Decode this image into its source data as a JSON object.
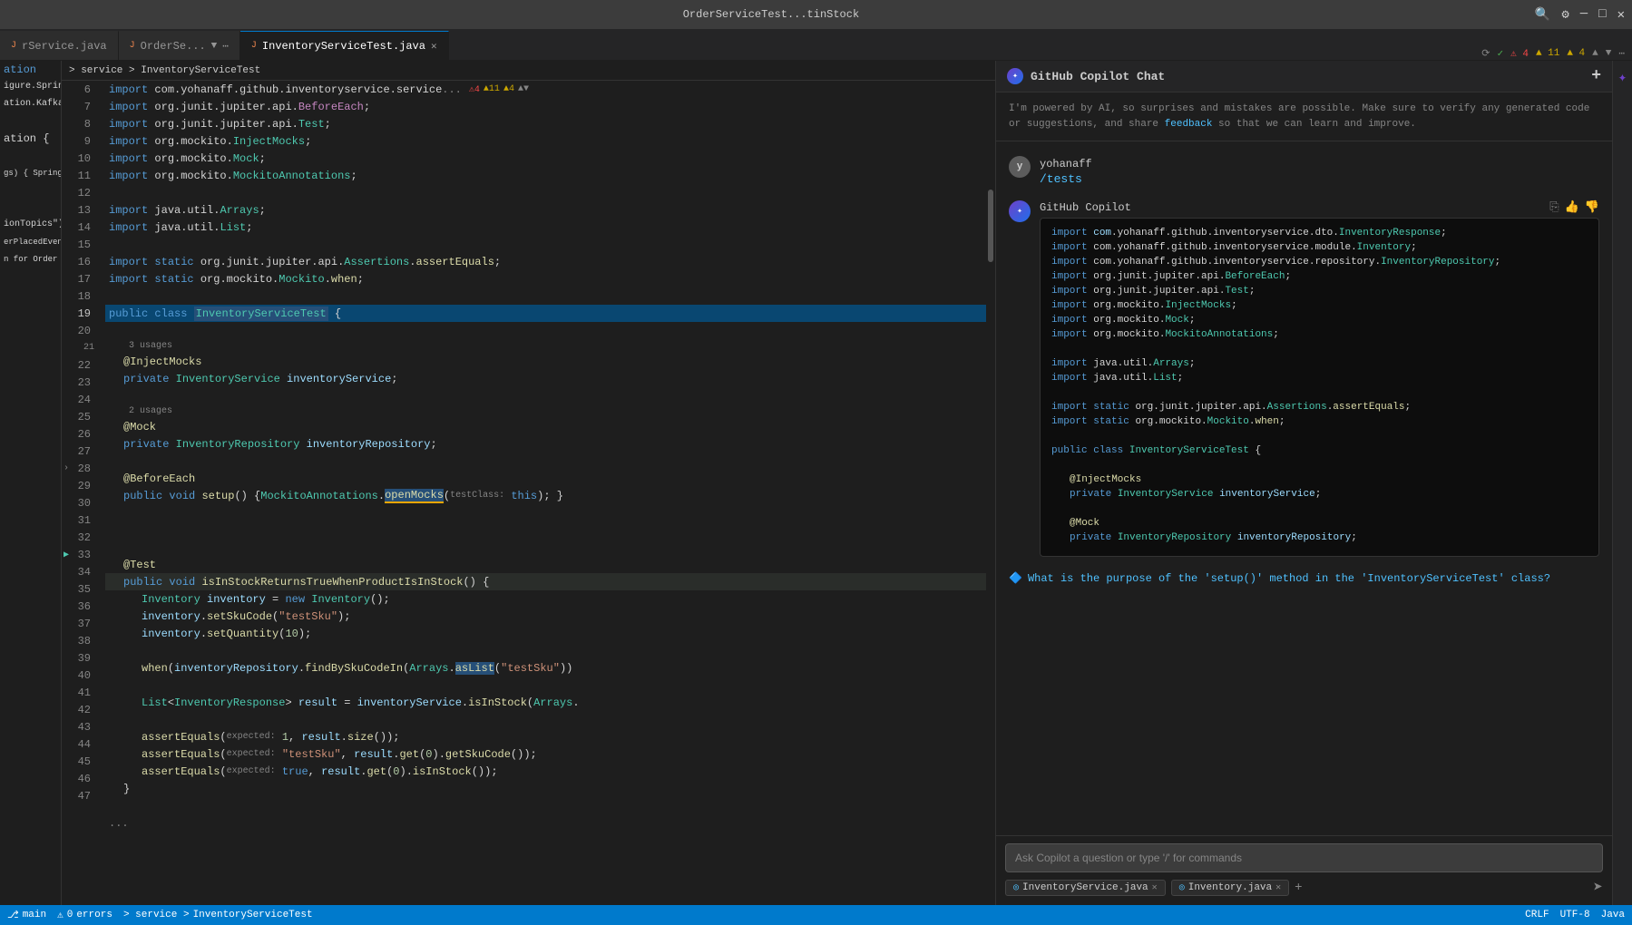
{
  "titleBar": {
    "projectName": "OrderServiceTest...tinStock",
    "controls": [
      "minimize",
      "maximize",
      "close"
    ]
  },
  "tabs": [
    {
      "id": "tab-orderservice",
      "label": "rService.java",
      "active": false,
      "modified": false
    },
    {
      "id": "tab-orderservicetest",
      "label": "OrderSe...",
      "active": false,
      "modified": false,
      "hasArrow": true
    },
    {
      "id": "tab-inventoryservicetest",
      "label": "InventoryServiceTest.java",
      "active": true,
      "modified": false
    }
  ],
  "editorToolbar": {
    "checkIcon": "✓",
    "refreshIcon": "⟳",
    "errorCount": "4",
    "warnCount": "11",
    "warnCount2": "4",
    "errorIcon": "⚠",
    "arrowUp": "▲",
    "arrowDown": "▼",
    "menuIcon": "⋯"
  },
  "leftGutterLines": [
    "Application;",
    "igure.SpringBootApplication;",
    "ation.KafkaListener;",
    "",
    "ation {",
    "",
    "gs) { SpringApplication.run(Notif",
    "",
    "",
    "ionTopics\")",
    "erPlacedEvent orderPlacedEvent) {",
    "n for Order - {}\", orderPlacedEven"
  ],
  "codeLines": [
    {
      "num": 6,
      "content": "import com.yohanaff.github.inventoryservice.service...",
      "type": "import"
    },
    {
      "num": 7,
      "content": "import org.junit.jupiter.api.BeforeEach;",
      "type": "import"
    },
    {
      "num": 8,
      "content": "import org.junit.jupiter.api.Test;",
      "type": "import"
    },
    {
      "num": 9,
      "content": "import org.mockito.InjectMocks;",
      "type": "import"
    },
    {
      "num": 10,
      "content": "import org.mockito.Mock;",
      "type": "import"
    },
    {
      "num": 11,
      "content": "import org.mockito.MockitoAnnotations;",
      "type": "import"
    },
    {
      "num": 12,
      "content": ""
    },
    {
      "num": 13,
      "content": "import java.util.Arrays;",
      "type": "import"
    },
    {
      "num": 14,
      "content": "import java.util.List;",
      "type": "import"
    },
    {
      "num": 15,
      "content": ""
    },
    {
      "num": 16,
      "content": "import static org.junit.jupiter.api.Assertions.assertEquals;",
      "type": "import"
    },
    {
      "num": 17,
      "content": "import static org.mockito.Mockito.when;",
      "type": "import"
    },
    {
      "num": 18,
      "content": ""
    },
    {
      "num": 19,
      "content": "public class InventoryServiceTest {",
      "type": "class",
      "highlighted": true
    },
    {
      "num": 20,
      "content": ""
    },
    {
      "num": 21,
      "content": "    @InjectMocks",
      "type": "annotation",
      "hasUsages": true,
      "usages": "3 usages"
    },
    {
      "num": 22,
      "content": "    private InventoryService inventoryService;",
      "type": "field"
    },
    {
      "num": 23,
      "content": ""
    },
    {
      "num": 24,
      "content": "    @Mock",
      "type": "annotation",
      "hasUsages": true,
      "usages": "2 usages"
    },
    {
      "num": 25,
      "content": "    private InventoryRepository inventoryRepository;",
      "type": "field"
    },
    {
      "num": 26,
      "content": ""
    },
    {
      "num": 27,
      "content": "    @BeforeEach",
      "type": "annotation"
    },
    {
      "num": 28,
      "content": "    public void setup() { MockitoAnnotations.openMocks( testClass: this); }",
      "type": "method",
      "hasFold": true
    },
    {
      "num": 29,
      "content": ""
    },
    {
      "num": 30,
      "content": ""
    },
    {
      "num": 31,
      "content": ""
    },
    {
      "num": 32,
      "content": "    @Test",
      "type": "annotation"
    },
    {
      "num": 33,
      "content": "    public void isInStockReturnsTrueWhenProductIsInStock() {",
      "type": "method",
      "hasRun": true
    },
    {
      "num": 34,
      "content": "        Inventory inventory = new Inventory();",
      "type": "code"
    },
    {
      "num": 35,
      "content": "        inventory.setSkuCode(\"testSku\");",
      "type": "code"
    },
    {
      "num": 36,
      "content": "        inventory.setQuantity(10);",
      "type": "code"
    },
    {
      "num": 37,
      "content": ""
    },
    {
      "num": 38,
      "content": "        when(inventoryRepository.findBySkuCodeIn(Arrays.asList(\"testSku\"))",
      "type": "code"
    },
    {
      "num": 39,
      "content": ""
    },
    {
      "num": 40,
      "content": "        List<InventoryResponse> result = inventoryService.isInStock(Arrays.",
      "type": "code"
    },
    {
      "num": 41,
      "content": ""
    },
    {
      "num": 42,
      "content": "        assertEquals( expected: 1, result.size());",
      "type": "code"
    },
    {
      "num": 43,
      "content": "        assertEquals( expected: \"testSku\", result.get(0).getSkuCode());",
      "type": "code"
    },
    {
      "num": 44,
      "content": "        assertEquals( expected: true, result.get(0).isInStock());",
      "type": "code"
    },
    {
      "num": 45,
      "content": "    }",
      "type": "code"
    },
    {
      "num": 46,
      "content": ""
    },
    {
      "num": 47,
      "content": "..."
    }
  ],
  "copilot": {
    "title": "GitHub Copilot Chat",
    "addIcon": "+",
    "disclaimer": "I'm powered by AI, so surprises and mistakes are possible. Make sure to verify any generated code or suggestions, and share feedback so that we can learn and improve.",
    "feedbackLink": "feedback",
    "userMessage": {
      "username": "yohanaff",
      "text": "/tests"
    },
    "copilotResponse": {
      "codeLines": [
        "import com.yohanaff.github.inventoryservice.dto.InventoryResponse;",
        "import com.yohanaff.github.inventoryservice.module.Inventory;",
        "import com.yohanaff.github.inventoryservice.repository.InventoryRepository;",
        "import org.junit.jupiter.api.BeforeEach;",
        "import org.junit.jupiter.api.Test;",
        "import org.mockito.InjectMocks;",
        "import org.mockito.Mock;",
        "import org.mockito.MockitoAnnotations;",
        "",
        "import java.util.Arrays;",
        "import java.util.List;",
        "",
        "import static org.junit.jupiter.api.Assertions.assertEquals;",
        "import static org.mockito.Mockito.when;",
        "",
        "public class InventoryServiceTest {",
        "",
        "    @InjectMocks",
        "    private InventoryService inventoryService;",
        "",
        "    @Mock",
        "    private InventoryRepository inventoryRepository;"
      ]
    },
    "questionSuggestion": "What is the purpose of the 'setup()' method in the 'InventoryServiceTest' class?",
    "inputPlaceholder": "Ask Copilot a question or type '/' for commands",
    "contextTags": [
      {
        "label": "InventoryService.java",
        "icon": "◎"
      },
      {
        "label": "Inventory.java",
        "icon": "◎"
      }
    ]
  },
  "statusBar": {
    "gitBranch": "main",
    "errors": "0",
    "warnings": "0",
    "encoding": "UTF-8",
    "lineEnding": "CRLF",
    "language": "Java",
    "breadcrumb": "service > InventoryServiceTest"
  }
}
